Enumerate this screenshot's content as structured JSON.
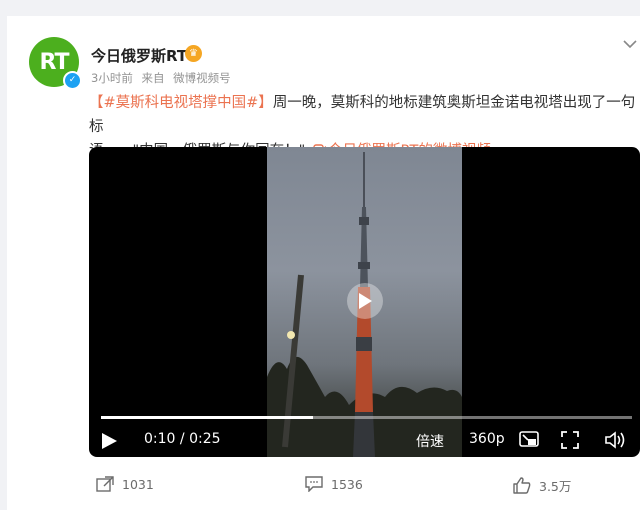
{
  "post": {
    "author": "今日俄罗斯RT",
    "avatar_text": "RT",
    "vip_badge": "♛",
    "time": "3小时前",
    "source_prefix": "来自",
    "source": "微博视频号",
    "hashtag": "【#莫斯科电视塔撑中国#】",
    "body_line1": "周一晚，莫斯科的地标建筑奥斯坦金诺电视塔出现了一句标",
    "body_line2": "语——\"中国，俄罗斯与你同在！\"",
    "video_link": "今日俄罗斯RT的微博视频"
  },
  "video": {
    "current_time": "0:10",
    "separator": "/",
    "duration": "0:25",
    "progress": 0.4,
    "speed_label": "倍速",
    "quality_label": "360p"
  },
  "actions": {
    "share_count": "1031",
    "comment_count": "1536",
    "like_count": "3.5万"
  },
  "icons": [
    "verified-icon",
    "vip-icon",
    "chevron-down-icon",
    "play-icon",
    "pip-icon",
    "fullscreen-icon",
    "volume-icon",
    "share-icon",
    "comment-icon",
    "like-icon",
    "video-link-icon"
  ],
  "colors": {
    "accent": "#eb7350",
    "avatar_green": "#4caf1e",
    "verify_blue": "#1da1f2"
  }
}
